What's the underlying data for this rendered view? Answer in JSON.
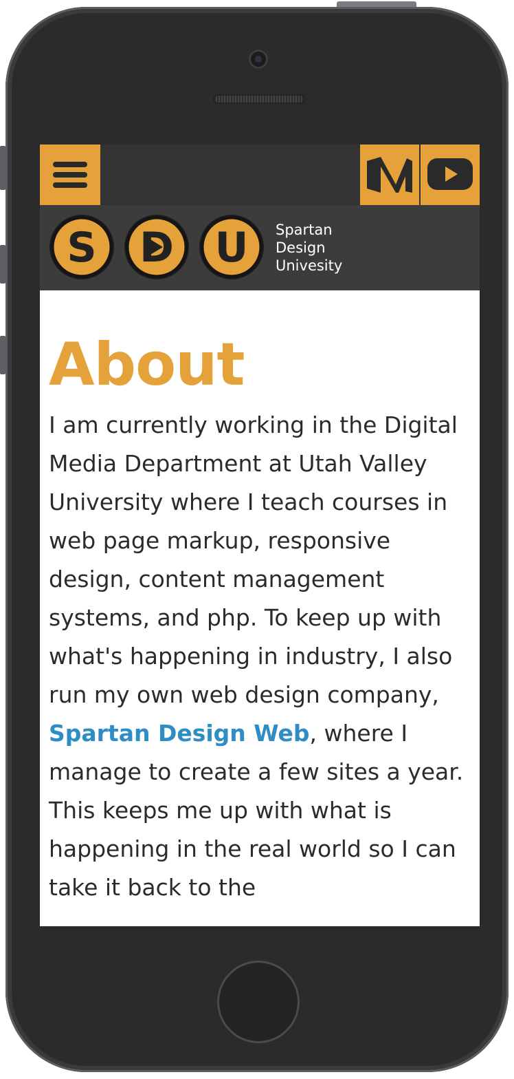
{
  "brand": {
    "letters": [
      "S",
      "D",
      "U"
    ],
    "name_lines": [
      "Spartan",
      "Design",
      "Univesity"
    ]
  },
  "header": {
    "menu_icon": "hamburger-menu-icon",
    "social_icons": [
      "medium-icon",
      "youtube-icon"
    ]
  },
  "page": {
    "title": "About",
    "paragraph_before_link": "I am currently working in the Digital Media Department at Utah Valley University where I teach courses in web page markup, responsive design, content management systems, and php. To keep up with what's happening in industry, I also run my own web design company, ",
    "link_text": "Spartan Design Web",
    "paragraph_after_link": ", where I manage to create a few sites a year. This keeps me up with what is happening in the real world so I can take it back to the"
  },
  "colors": {
    "accent": "#e5a13a",
    "link": "#2e8dc4",
    "header_bg": "#333333",
    "brand_bg": "#3c3c3c",
    "text": "#2b2b2b"
  }
}
